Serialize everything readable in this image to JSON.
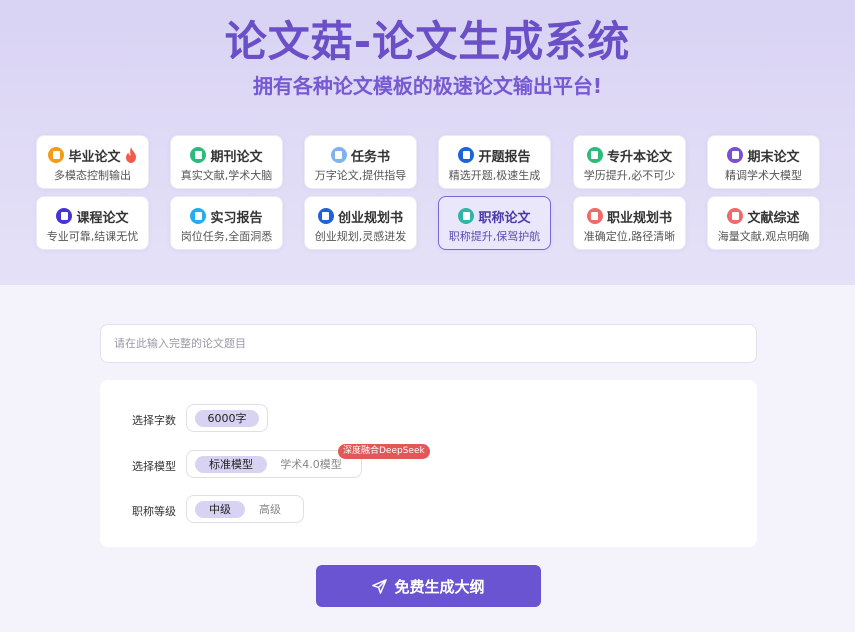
{
  "header": {
    "title": "论文菇-论文生成系统",
    "subtitle": "拥有各种论文模板的极速论文输出平台!"
  },
  "cards": [
    {
      "title": "毕业论文",
      "desc": "多模态控制输出",
      "icon": "graduation-doc-icon",
      "color": "#f59a1b",
      "hot": true
    },
    {
      "title": "期刊论文",
      "desc": "真实文献,学术大脑",
      "icon": "journal-icon",
      "color": "#2dbb7c"
    },
    {
      "title": "任务书",
      "desc": "万字论文,提供指导",
      "icon": "task-book-icon",
      "color": "#7fb2ee"
    },
    {
      "title": "开题报告",
      "desc": "精选开题,极速生成",
      "icon": "report-icon",
      "color": "#1e64d8"
    },
    {
      "title": "专升本论文",
      "desc": "学历提升,必不可少",
      "icon": "upgrade-book-icon",
      "color": "#2dbb7c"
    },
    {
      "title": "期末论文",
      "desc": "精调学术大模型",
      "icon": "final-exam-icon",
      "color": "#7a4fd1"
    },
    {
      "title": "课程论文",
      "desc": "专业可靠,结课无忧",
      "icon": "course-icon",
      "color": "#4734d4"
    },
    {
      "title": "实习报告",
      "desc": "岗位任务,全面洞悉",
      "icon": "internship-icon",
      "color": "#22aef0"
    },
    {
      "title": "创业规划书",
      "desc": "创业规划,灵感进发",
      "icon": "startup-plan-icon",
      "color": "#1e64d8"
    },
    {
      "title": "职称论文",
      "desc": "职称提升,保驾护航",
      "icon": "title-paper-icon",
      "color": "#2fb6a5",
      "active": true
    },
    {
      "title": "职业规划书",
      "desc": "准确定位,路径清晰",
      "icon": "career-plan-icon",
      "color": "#ef6a6a"
    },
    {
      "title": "文献综述",
      "desc": "海量文献,观点明确",
      "icon": "literature-review-icon",
      "color": "#ef6a6a"
    }
  ],
  "topic": {
    "placeholder": "请在此输入完整的论文题目",
    "value": ""
  },
  "options": {
    "word_count": {
      "label": "选择字数",
      "choices": [
        "6000字"
      ],
      "selected": "6000字"
    },
    "model": {
      "label": "选择模型",
      "choices": [
        "标准模型",
        "学术4.0模型"
      ],
      "selected": "标准模型",
      "badge": "深度融合DeepSeek"
    },
    "level": {
      "label": "职称等级",
      "choices": [
        "中级",
        "高级"
      ],
      "selected": "中级"
    }
  },
  "submit": {
    "label": "免费生成大纲",
    "icon": "send-icon"
  }
}
